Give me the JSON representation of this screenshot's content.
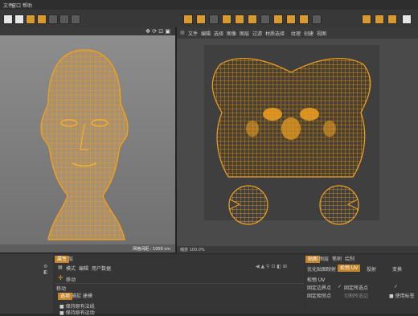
{
  "menubar": {
    "items": [
      "文件",
      "编辑",
      "创建",
      "选择",
      "工具",
      "网格",
      "样条",
      "体积",
      "运动图形",
      "角色",
      "动画",
      "模拟",
      "跟踪器",
      "渲染",
      "扩展",
      "窗口",
      "帮助"
    ]
  },
  "left_viewport": {
    "status": "网格间距 : 1000 cm"
  },
  "uv_menu": {
    "items": [
      "文件",
      "编辑",
      "选择",
      "图像",
      "图层",
      "过滤",
      "材质选择",
      "纹理",
      "创建",
      "视图",
      "纹理"
    ]
  },
  "uv_status": "缩放 100.0%",
  "mid_panel": {
    "tabs": [
      "属性",
      "层"
    ],
    "menu": [
      "模式",
      "编辑",
      "用户数据"
    ],
    "tool_title": "移动",
    "subtitle": "移动",
    "subtabs": [
      "选项",
      "捕捉",
      "建模"
    ],
    "options": [
      "保持原有法线",
      "保持原有运动"
    ]
  },
  "right_panel": {
    "tabs": [
      "贴图",
      "图层",
      "笔刷",
      "绘制"
    ],
    "subtabs": [
      "优化贴图映射",
      "松弛 UV",
      "投射",
      "变换"
    ],
    "section": "松弛 UV",
    "fields": [
      "固定边界点",
      "固定所选点",
      "固定相邻点",
      "切割所选边",
      "使用标签"
    ],
    "checked": [
      "固定边界点",
      "固定所选点"
    ]
  },
  "colors": {
    "accent": "#e6a52e",
    "wire": "#f0a020",
    "bg": "#2b2b2b"
  }
}
